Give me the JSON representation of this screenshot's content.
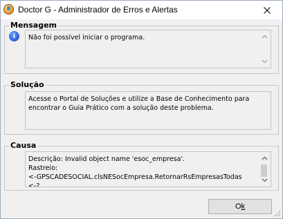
{
  "window": {
    "title": "Doctor G - Administrador de Erros e Alertas"
  },
  "mensagem": {
    "label": "Mensagem",
    "text": "Não foi possível iniciar o programa."
  },
  "solucao": {
    "label": "Solução",
    "text": "Acesse o Portal de Soluções e utilize a Base de Conhecimento para encontrar o Guia Prático com a solução deste problema."
  },
  "causa": {
    "label": "Causa",
    "text": "Descrição: Invalid object name 'esoc_empresa'.\nRastreio:\n<-GPSCADESOCIAL.clsNESocEmpresa.RetornarRsEmpresasTodas\n<-?."
  },
  "buttons": {
    "ok_label": "O",
    "ok_mnemonic": "k"
  },
  "icons": {
    "app": "doctor-g-app-icon",
    "close": "close-icon",
    "info": "info-icon"
  },
  "colors": {
    "window_bg": "#f0f0f0",
    "info_blue": "#2f62d9",
    "border": "#c9c9c9"
  }
}
